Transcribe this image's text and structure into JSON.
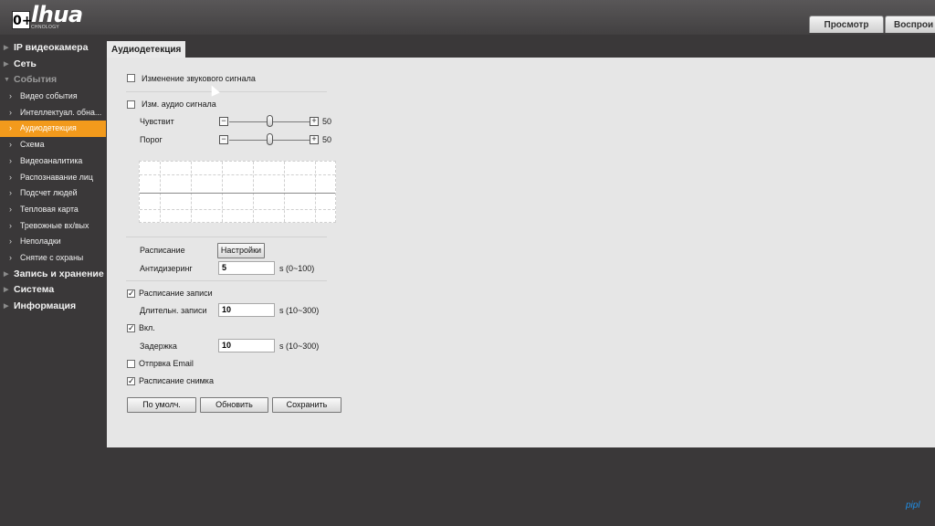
{
  "header": {
    "logo_text": "lhua",
    "logo_subtitle": "CHNOLOGY",
    "age_rating": "0+",
    "tabs": [
      "Просмотр",
      "Воспрои"
    ]
  },
  "sidebar": {
    "items": [
      {
        "label": "IP видеокамера",
        "level": "main"
      },
      {
        "label": "Сеть",
        "level": "main"
      },
      {
        "label": "События",
        "level": "main",
        "expanded": true
      },
      {
        "label": "Видео события",
        "level": "sub"
      },
      {
        "label": "Интеллектуал. обна...",
        "level": "sub"
      },
      {
        "label": "Аудиодетекция",
        "level": "sub",
        "active": true
      },
      {
        "label": "Схема",
        "level": "sub"
      },
      {
        "label": "Видеоаналитика",
        "level": "sub"
      },
      {
        "label": "Распознавание лиц",
        "level": "sub"
      },
      {
        "label": "Подсчет людей",
        "level": "sub"
      },
      {
        "label": "Тепловая карта",
        "level": "sub"
      },
      {
        "label": "Тревожные вх/вых",
        "level": "sub"
      },
      {
        "label": "Неполадки",
        "level": "sub"
      },
      {
        "label": "Снятие с охраны",
        "level": "sub"
      },
      {
        "label": "Запись и хранение",
        "level": "main"
      },
      {
        "label": "Система",
        "level": "main"
      },
      {
        "label": "Информация",
        "level": "main"
      }
    ]
  },
  "content": {
    "tab_title": "Аудиодетекция",
    "audio_change": {
      "label": "Изменение звукового сигнала",
      "checked": false
    },
    "audio_level": {
      "label": "Изм. аудио сигнала",
      "checked": false
    },
    "sensitivity": {
      "label": "Чувствит",
      "value": "50",
      "level": 0.5
    },
    "threshold": {
      "label": "Порог",
      "value": "50",
      "level": 0.5
    },
    "schedule": {
      "label": "Расписание",
      "button": "Настройки"
    },
    "antidither": {
      "label": "Антидизеринг",
      "value": "5",
      "unit": "s (0~100)"
    },
    "record_schedule": {
      "label": "Расписание записи",
      "checked": true
    },
    "record_duration": {
      "label": "Длительн. записи",
      "value": "10",
      "unit": "s (10~300)"
    },
    "enable": {
      "label": "Вкл.",
      "checked": true
    },
    "delay": {
      "label": "Задержка",
      "value": "10",
      "unit": "s (10~300)"
    },
    "send_email": {
      "label": "Отпрвка Email",
      "checked": false
    },
    "snapshot_schedule": {
      "label": "Расписание снимка",
      "checked": true
    },
    "buttons": {
      "default": "По умолч.",
      "refresh": "Обновить",
      "save": "Сохранить"
    }
  },
  "watermark": "pipl",
  "colors": {
    "accent": "#f29a1c",
    "sidebar_bg": "#3a3839",
    "panel_bg": "#e6e6e6"
  }
}
